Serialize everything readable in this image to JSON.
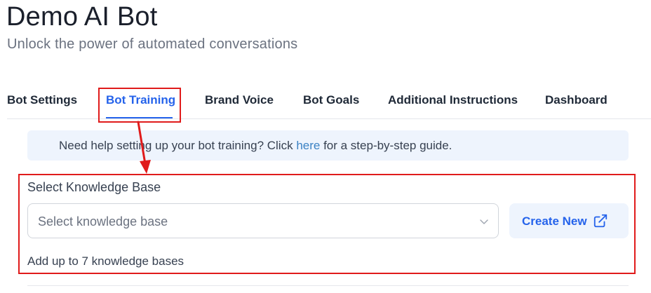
{
  "header": {
    "title": "Demo AI Bot",
    "subtitle": "Unlock the power of automated conversations"
  },
  "tabs": [
    {
      "label": "Bot Settings",
      "active": false
    },
    {
      "label": "Bot Training",
      "active": true
    },
    {
      "label": "Brand Voice",
      "active": false
    },
    {
      "label": "Bot Goals",
      "active": false
    },
    {
      "label": "Additional Instructions",
      "active": false
    },
    {
      "label": "Dashboard",
      "active": false
    }
  ],
  "help_banner": {
    "text_before": "Need help setting up your bot training? Click ",
    "link_text": "here",
    "text_after": " for a step-by-step guide."
  },
  "knowledge_base": {
    "label": "Select Knowledge Base",
    "placeholder": "Select knowledge base",
    "create_button_label": "Create New",
    "hint": "Add up to 7 knowledge bases"
  },
  "icons": {
    "dropdown": "chevron-down-icon",
    "create": "external-link-icon"
  },
  "colors": {
    "accent": "#2563eb",
    "banner_bg": "#eef4fd",
    "annotation": "#e01b1b"
  }
}
